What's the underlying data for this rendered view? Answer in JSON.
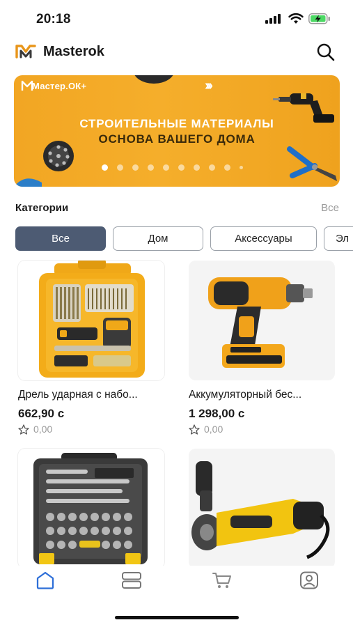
{
  "status_bar": {
    "time": "20:18"
  },
  "header": {
    "title": "Masterok",
    "logo_icon": "masterok-logo-icon",
    "search_icon": "search-icon"
  },
  "banner": {
    "brand": "Мастер.ОК+",
    "line1": "СТРОИТЕЛЬНЫЕ МАТЕРИАЛЫ",
    "line2": "ОСНОВА ВАШЕГО ДОМА",
    "slides_total": 10,
    "active_slide": 1
  },
  "categories": {
    "title": "Категории",
    "see_all": "Все",
    "chips": [
      {
        "label": "Все",
        "active": true
      },
      {
        "label": "Дом",
        "active": false
      },
      {
        "label": "Аксессуары",
        "active": false
      },
      {
        "label": "Эл",
        "active": false
      }
    ]
  },
  "products": [
    {
      "name": "Дрель ударная с набо...",
      "price": "662,90 с",
      "rating": "0,00"
    },
    {
      "name": "Аккумуляторный бес...",
      "price": "1 298,00 с",
      "rating": "0,00"
    },
    {
      "name": "",
      "price": "",
      "rating": ""
    },
    {
      "name": "",
      "price": "",
      "rating": ""
    }
  ],
  "tab_bar": {
    "items": [
      {
        "icon": "home-icon",
        "active": true
      },
      {
        "icon": "catalog-icon",
        "active": false
      },
      {
        "icon": "cart-icon",
        "active": false
      },
      {
        "icon": "profile-icon",
        "active": false
      }
    ]
  },
  "colors": {
    "accent": "#4d5b73",
    "banner": "#f2a623",
    "logo": "#e8951a",
    "active_tab": "#2e6fd8"
  }
}
